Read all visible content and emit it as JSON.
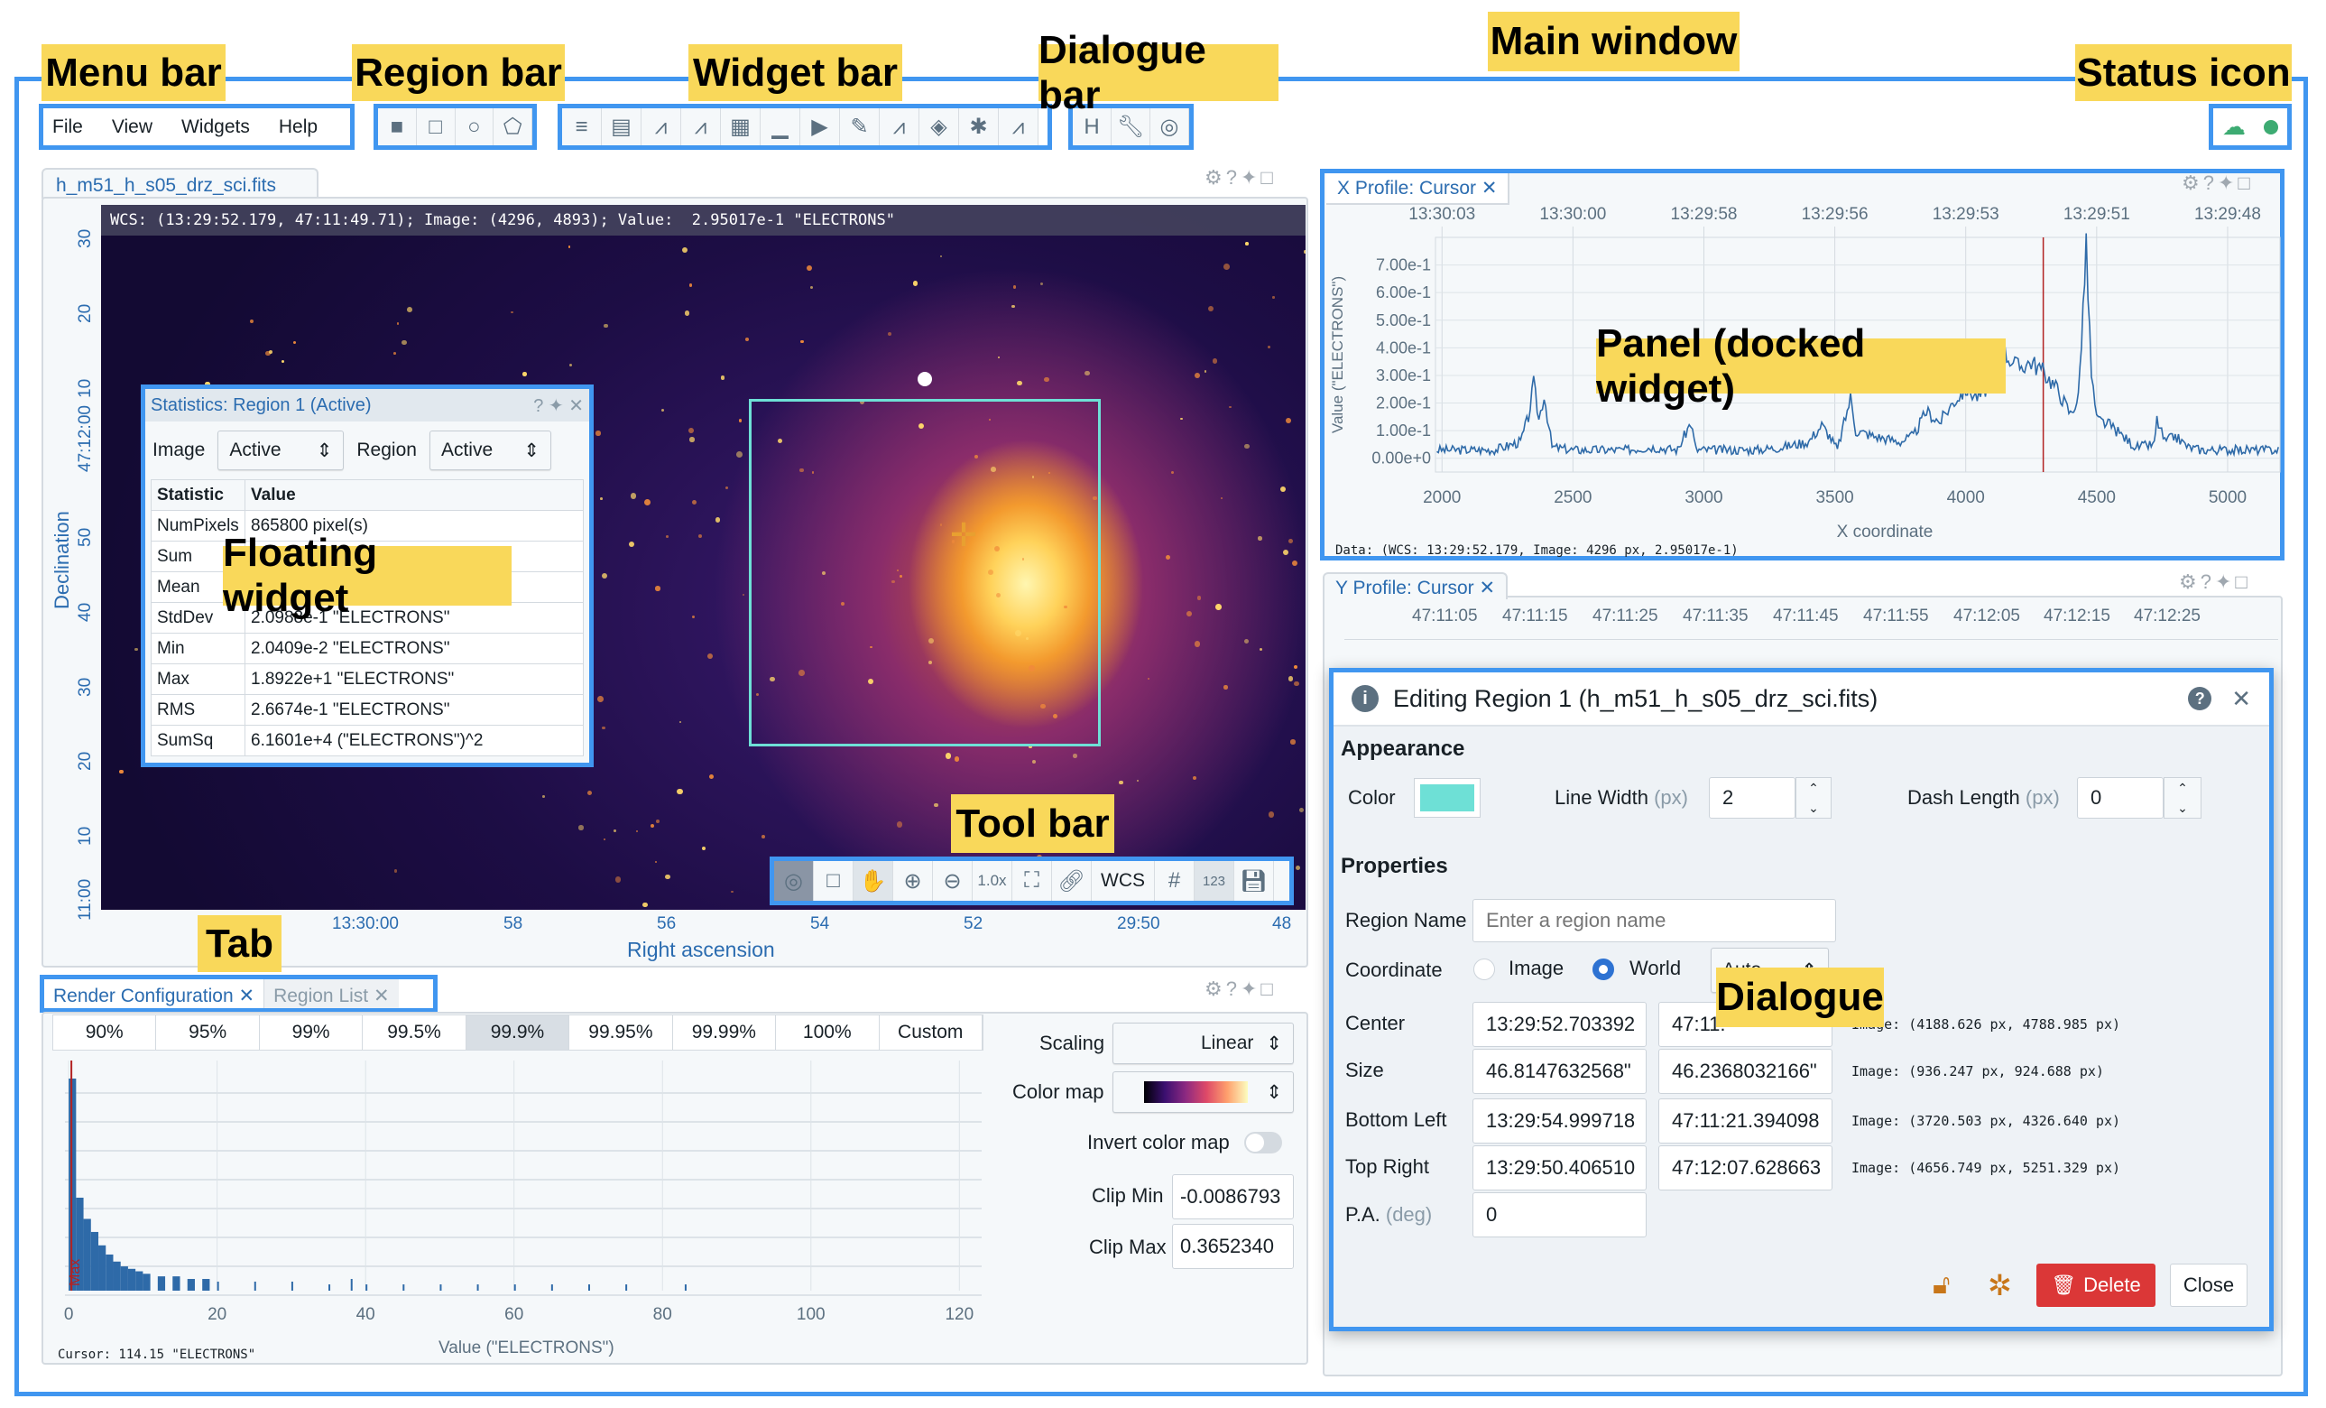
{
  "annotations": {
    "menu_bar": "Menu bar",
    "region_bar": "Region bar",
    "widget_bar": "Widget bar",
    "dialogue_bar": "Dialogue bar",
    "main_window": "Main window",
    "status_icon": "Status icon",
    "floating_widget": "Floating widget",
    "tool_bar": "Tool bar",
    "tab": "Tab",
    "panel": "Panel (docked widget)",
    "dialogue": "Dialogue"
  },
  "menu": {
    "items": [
      "File",
      "View",
      "Widgets",
      "Help"
    ]
  },
  "region_bar": {
    "icons": [
      "point-icon",
      "rectangle-icon",
      "ellipse-icon",
      "polygon-icon"
    ]
  },
  "widget_bar": {
    "icons": [
      "region-list-icon",
      "image-info-icon",
      "xy-profile-icon",
      "z-profile-icon",
      "statistics-icon",
      "histogram-icon",
      "animator-icon",
      "stokes-icon",
      "spectral-profile-icon",
      "layers-icon",
      "catalog-icon",
      "cursor-profile-icon"
    ]
  },
  "dialogue_bar": {
    "icons": [
      "header-icon",
      "preferences-icon",
      "contours-icon"
    ]
  },
  "status": {
    "connection_icon": "cloud-connected-icon",
    "dot_color": "#3dab72"
  },
  "image_view": {
    "tab": "h_m51_h_s05_drz_sci.fits",
    "cursor_info": "WCS: (13:29:52.179, 47:11:49.71); Image: (4296, 4893); Value:  2.95017e-1 \"ELECTRONS\"",
    "dec_ticks": [
      "30",
      "20",
      "10",
      "47:12:00",
      "50",
      "40",
      "30",
      "20",
      "10",
      "11:00"
    ],
    "ra_ticks": [
      "13:30:00",
      "58",
      "56",
      "54",
      "52",
      "29:50",
      "48"
    ],
    "xlabel": "Right ascension",
    "ylabel": "Declination",
    "region_color": "#6ee0d6",
    "toolbar": {
      "zoom": "1.0x",
      "coord": "WCS",
      "labels": "123"
    }
  },
  "stats": {
    "title": "Statistics: Region 1 (Active)",
    "image_label": "Image",
    "image_value": "Active",
    "region_label": "Region",
    "region_value": "Active",
    "headers": [
      "Statistic",
      "Value"
    ],
    "rows": [
      [
        "NumPixels",
        "865800 pixel(s)"
      ],
      [
        "Sum",
        ""
      ],
      [
        "Mean",
        ""
      ],
      [
        "StdDev",
        "2.0988e-1 \"ELECTRONS\""
      ],
      [
        "Min",
        "2.0409e-2 \"ELECTRONS\""
      ],
      [
        "Max",
        "1.8922e+1 \"ELECTRONS\""
      ],
      [
        "RMS",
        "2.6674e-1 \"ELECTRONS\""
      ],
      [
        "SumSq",
        "6.1601e+4 (\"ELECTRONS\")^2"
      ]
    ]
  },
  "render": {
    "tabs": [
      "Render Configuration",
      "Region List"
    ],
    "percentiles": [
      "90%",
      "95%",
      "99%",
      "99.5%",
      "99.9%",
      "99.95%",
      "99.99%",
      "100%",
      "Custom"
    ],
    "selected_percentile": "99.9%",
    "scaling_label": "Scaling",
    "scaling": "Linear",
    "colormap_label": "Color map",
    "invert_label": "Invert color map",
    "invert": false,
    "clip_min_label": "Clip Min",
    "clip_min": "-0.0086793",
    "clip_max_label": "Clip Max",
    "clip_max": "0.3652340",
    "cursor": "Cursor: 114.15 \"ELECTRONS\"",
    "xlabel": "Value (\"ELECTRONS\")",
    "marker": "Max"
  },
  "xprofile": {
    "tab": "X Profile: Cursor",
    "data": "Data: (WCS: 13:29:52.179, Image: 4296 px, 2.95017e-1)"
  },
  "yprofile": {
    "tab": "Y Profile: Cursor",
    "top_ticks": [
      "47:11:05",
      "47:11:15",
      "47:11:25",
      "47:11:35",
      "47:11:45",
      "47:11:55",
      "47:12:05",
      "47:12:15",
      "47:12:25"
    ]
  },
  "chart_data": [
    {
      "type": "line",
      "xlabel": "X coordinate",
      "ylabel": "Value (\"ELECTRONS\")",
      "xlim": [
        1975,
        5200
      ],
      "ylim": [
        -0.05,
        0.8
      ],
      "grid": true,
      "xticks": [
        2000,
        2500,
        3000,
        3500,
        4000,
        4500,
        5000
      ],
      "yticks": [
        "0.00e+0",
        "1.00e-1",
        "2.00e-1",
        "3.00e-1",
        "4.00e-1",
        "5.00e-1",
        "6.00e-1",
        "7.00e-1"
      ],
      "top_ticks": [
        "13:30:03",
        "13:30:00",
        "13:29:58",
        "13:29:56",
        "13:29:53",
        "13:29:51",
        "13:29:48"
      ],
      "cursor_x": 4296,
      "x": [
        1980,
        2100,
        2200,
        2300,
        2330,
        2350,
        2370,
        2390,
        2420,
        2500,
        2600,
        2700,
        2800,
        2900,
        2950,
        2970,
        3100,
        3200,
        3300,
        3400,
        3450,
        3480,
        3510,
        3560,
        3580,
        3650,
        3700,
        3750,
        3800,
        3850,
        3900,
        3950,
        4000,
        4050,
        4100,
        4150,
        4200,
        4250,
        4300,
        4350,
        4400,
        4430,
        4460,
        4480,
        4500,
        4550,
        4600,
        4650,
        4720,
        4730,
        4760,
        4800,
        4850,
        4900,
        5000,
        5200
      ],
      "y": [
        0.03,
        0.03,
        0.03,
        0.06,
        0.15,
        0.27,
        0.14,
        0.23,
        0.04,
        0.03,
        0.03,
        0.03,
        0.04,
        0.03,
        0.13,
        0.03,
        0.03,
        0.03,
        0.04,
        0.06,
        0.12,
        0.08,
        0.03,
        0.22,
        0.1,
        0.08,
        0.07,
        0.06,
        0.08,
        0.17,
        0.13,
        0.2,
        0.25,
        0.22,
        0.28,
        0.38,
        0.33,
        0.35,
        0.31,
        0.25,
        0.16,
        0.22,
        0.76,
        0.3,
        0.14,
        0.12,
        0.08,
        0.04,
        0.05,
        0.14,
        0.06,
        0.08,
        0.04,
        0.03,
        0.03,
        0.03
      ]
    },
    {
      "type": "bar",
      "xlabel": "Value (\"ELECTRONS\")",
      "xlim": [
        -0.5,
        123
      ],
      "xticks": [
        0,
        20,
        40,
        60,
        80,
        100,
        120
      ],
      "x": [
        0,
        1,
        2,
        3,
        4,
        5,
        6,
        7,
        8,
        9,
        10,
        12,
        14,
        16,
        18,
        20,
        25,
        30,
        35,
        38,
        40,
        45,
        50,
        55,
        60,
        65,
        70,
        75,
        83
      ],
      "counts_relative": [
        1.0,
        0.4,
        0.3,
        0.24,
        0.18,
        0.14,
        0.11,
        0.09,
        0.08,
        0.07,
        0.06,
        0.05,
        0.05,
        0.04,
        0.04,
        0.03,
        0.03,
        0.03,
        0.02,
        0.04,
        0.02,
        0.02,
        0.02,
        0.02,
        0.02,
        0.02,
        0.02,
        0.02,
        0.02
      ]
    }
  ],
  "dialog": {
    "title": "Editing Region 1 (h_m51_h_s05_drz_sci.fits)",
    "appearance": "Appearance",
    "color_label": "Color",
    "color": "#6ee0d6",
    "line_width_label": "Line Width",
    "line_width_unit": "(px)",
    "line_width": "2",
    "dash_label": "Dash Length",
    "dash_unit": "(px)",
    "dash": "0",
    "properties": "Properties",
    "name_label": "Region Name",
    "name_placeholder": "Enter a region name",
    "coord_label": "Coordinate",
    "coord_image": "Image",
    "coord_world": "World",
    "coord_system": "Auto",
    "rows": [
      {
        "label": "Center",
        "a": "13:29:52.703392",
        "b": "47:11:",
        "img": "Image: (4188.626 px, 4788.985 px)"
      },
      {
        "label": "Size",
        "a": "46.8147632568\"",
        "b": "46.2368032166\"",
        "img": "Image: (936.247 px, 924.688 px)"
      },
      {
        "label": "Bottom Left",
        "a": "13:29:54.999718",
        "b": "47:11:21.394098",
        "img": "Image: (3720.503 px, 4326.640 px)"
      },
      {
        "label": "Top Right",
        "a": "13:29:50.406510",
        "b": "47:12:07.628663",
        "img": "Image: (4656.749 px, 5251.329 px)"
      }
    ],
    "pa_label": "P.A.",
    "pa_unit": "(deg)",
    "pa": "0",
    "delete": "Delete",
    "close": "Close"
  }
}
